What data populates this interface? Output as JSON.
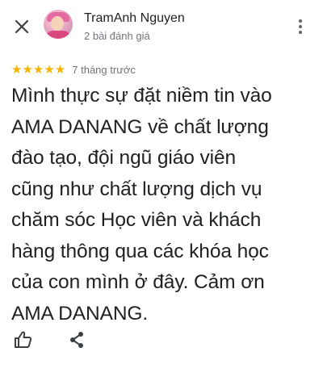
{
  "header": {
    "close_icon": "close-icon",
    "user_name": "TramAnh Nguyen",
    "user_meta": "2 bài đánh giá",
    "more_icon": "more-vert-icon"
  },
  "review": {
    "rating": 5,
    "stars": [
      "★",
      "★",
      "★",
      "★",
      "★"
    ],
    "date": "7 tháng trước",
    "text": "Mình thực sự đặt niềm tin vào\nAMA DANANG về chất lượng\nđào tạo, đội ngũ giáo viên\ncũng như chất lượng dịch vụ\nchăm sóc Học viên và khách\nhàng thông qua các khóa học\ncủa con mình ở đây. Cảm ơn\nAMA DANANG."
  },
  "actions": {
    "like_icon": "thumbs-up-icon",
    "share_icon": "share-icon"
  },
  "colors": {
    "star": "#f4b400",
    "text": "#202124",
    "secondary_text": "#70757a",
    "icon": "#5f6368"
  }
}
